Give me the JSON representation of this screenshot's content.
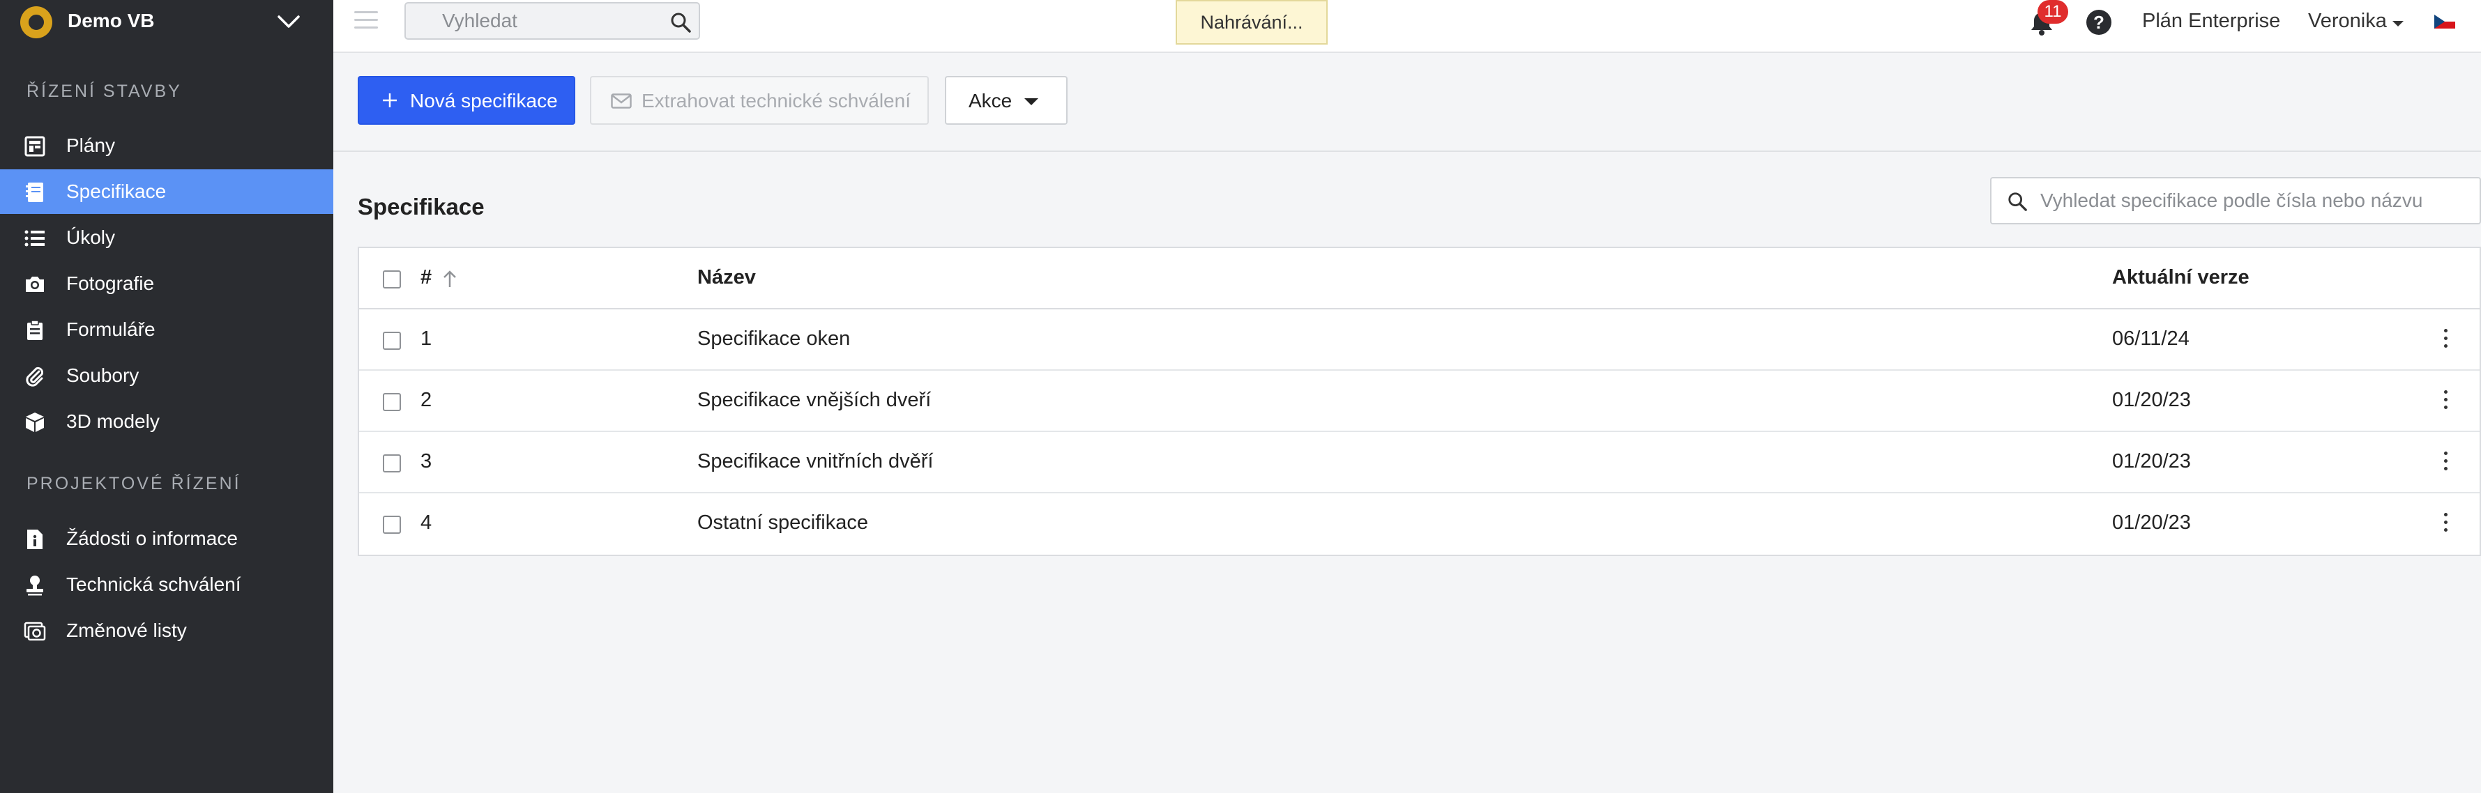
{
  "project": {
    "name": "Demo VB"
  },
  "sidebar": {
    "section1": "ŘÍZENÍ STAVBY",
    "section2": "PROJEKTOVÉ ŘÍZENÍ",
    "items": [
      {
        "label": "Plány",
        "icon": "plans-icon"
      },
      {
        "label": "Specifikace",
        "icon": "specifications-icon",
        "active": true
      },
      {
        "label": "Úkoly",
        "icon": "list-icon"
      },
      {
        "label": "Fotografie",
        "icon": "camera-icon"
      },
      {
        "label": "Formuláře",
        "icon": "clipboard-icon"
      },
      {
        "label": "Soubory",
        "icon": "paperclip-icon"
      },
      {
        "label": "3D modely",
        "icon": "cube-icon"
      },
      {
        "label": "Žádosti o informace",
        "icon": "info-document-icon"
      },
      {
        "label": "Technická schválení",
        "icon": "stamp-icon"
      },
      {
        "label": "Změnové listy",
        "icon": "change-order-icon"
      }
    ]
  },
  "topbar": {
    "search_placeholder": "Vyhledat",
    "loading": "Nahrávání...",
    "notifications": "11",
    "help": "?",
    "plan": "Plán Enterprise",
    "user": "Veronika"
  },
  "toolbar": {
    "new_spec": "Nová specifikace",
    "extract": "Extrahovat technické schválení",
    "actions": "Akce"
  },
  "content": {
    "title": "Specifikace",
    "search_placeholder": "Vyhledat specifikace podle čísla nebo názvu"
  },
  "table": {
    "headers": {
      "num": "#",
      "name": "Název",
      "version": "Aktuální verze"
    },
    "rows": [
      {
        "num": "1",
        "name": "Specifikace oken",
        "version": "06/11/24"
      },
      {
        "num": "2",
        "name": "Specifikace vnějších dveří",
        "version": "01/20/23"
      },
      {
        "num": "3",
        "name": "Specifikace vnitřních dvěří",
        "version": "01/20/23"
      },
      {
        "num": "4",
        "name": "Ostatní specifikace",
        "version": "01/20/23"
      }
    ]
  },
  "colors": {
    "sidebar_bg": "#2a2c30",
    "active_item": "#5b92f5",
    "primary_button": "#2e5ff2",
    "badge": "#e02d2d"
  }
}
